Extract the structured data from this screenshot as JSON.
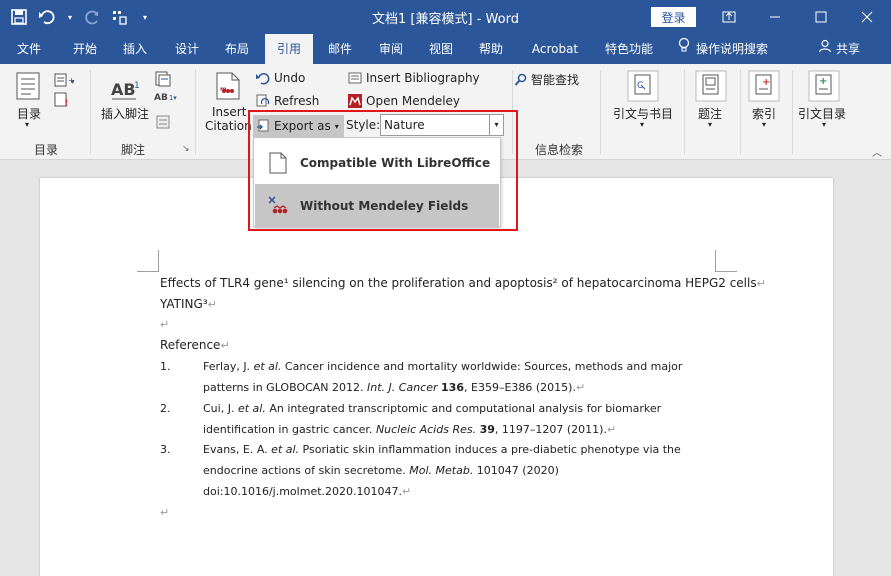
{
  "titlebar": {
    "title": "文档1 [兼容模式]  -  Word",
    "login_label": "登录"
  },
  "tabs": [
    "文件",
    "开始",
    "插入",
    "设计",
    "布局",
    "引用",
    "邮件",
    "审阅",
    "视图",
    "帮助",
    "Acrobat",
    "特色功能"
  ],
  "tell_me": "操作说明搜索",
  "share": "共享",
  "ribbon": {
    "toc_label": "目录",
    "toc_group": "目录",
    "footnote_label": "插入脚注",
    "footnote_group": "脚注",
    "ab_label": "AB",
    "insert_label": "Insert",
    "citation_label": "Citation",
    "undo_label": "Undo",
    "refresh_label": "Refresh",
    "export_label": "Export as",
    "insert_bib_label": "Insert Bibliography",
    "open_mendeley_label": "Open Mendeley",
    "style_label": "Style:",
    "style_value": "Nature",
    "smart_lookup_label": "智能查找",
    "research_group": "信息检索",
    "cite_bib_label": "引文与书目",
    "caption_label": "题注",
    "index_label": "索引",
    "toa_label": "引文目录"
  },
  "menu": {
    "item1": "Compatible With LibreOffice",
    "item2": "Without Mendeley Fields"
  },
  "document": {
    "title_line1": "Effects of TLR4 gene¹ silencing on the proliferation and apoptosis² of hepatocarcinoma HEPG2 cells",
    "title_line2": "YATING³",
    "reference_heading": "Reference",
    "refs": [
      {
        "num": "1.",
        "line1_a": "Ferlay, J. ",
        "line1_b": "et al.",
        "line1_c": " Cancer incidence and mortality worldwide: Sources, methods and major",
        "line2_a": "patterns in GLOBOCAN 2012. ",
        "line2_b": "Int. J. Cancer",
        "line2_c": " ",
        "line2_d": "136",
        "line2_e": ", E359–E386 (2015)."
      },
      {
        "num": "2.",
        "line1_a": "Cui, J. ",
        "line1_b": "et al.",
        "line1_c": " An integrated transcriptomic and computational analysis for biomarker",
        "line2_a": "identification in gastric cancer. ",
        "line2_b": "Nucleic Acids Res.",
        "line2_c": " ",
        "line2_d": "39",
        "line2_e": ", 1197–1207 (2011)."
      },
      {
        "num": "3.",
        "line1_a": "Evans, E. A. ",
        "line1_b": "et al.",
        "line1_c": " Psoriatic skin inflammation induces a pre-diabetic phenotype via the",
        "line2_a": "endocrine actions of skin secretome. ",
        "line2_b": "Mol. Metab.",
        "line2_c": " 101047 (2020)",
        "line3": "doi:10.1016/j.molmet.2020.101047."
      }
    ]
  }
}
